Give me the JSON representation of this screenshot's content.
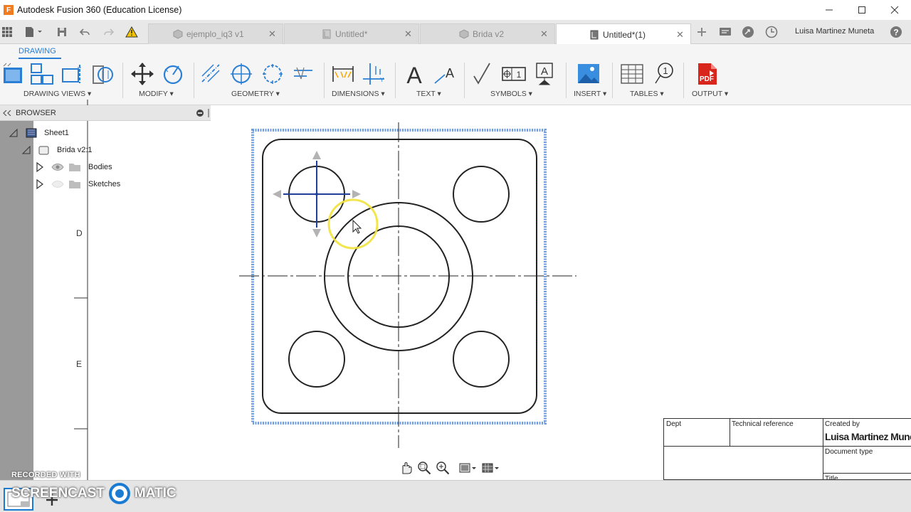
{
  "window": {
    "title": "Autodesk Fusion 360 (Education License)",
    "logo_letter": "F"
  },
  "tabs": [
    {
      "label": "ejemplo_iq3 v1",
      "icon": "part-icon",
      "active": false
    },
    {
      "label": "Untitled*",
      "icon": "drawing-icon",
      "active": false
    },
    {
      "label": "Brida v2",
      "icon": "part-icon",
      "active": false
    },
    {
      "label": "Untitled*(1)",
      "icon": "drawing-icon",
      "active": true
    }
  ],
  "user": {
    "name": "Luisa Martinez Muneta"
  },
  "ribbon": {
    "workspace": "DRAWING",
    "groups": [
      {
        "label": "DRAWING VIEWS ▾"
      },
      {
        "label": "MODIFY ▾"
      },
      {
        "label": "GEOMETRY ▾"
      },
      {
        "label": "DIMENSIONS ▾"
      },
      {
        "label": "TEXT ▾"
      },
      {
        "label": "SYMBOLS ▾"
      },
      {
        "label": "INSERT ▾"
      },
      {
        "label": "TABLES ▾"
      },
      {
        "label": "OUTPUT ▾"
      }
    ],
    "text_icon_letter": "A",
    "pdf_label": "PDF",
    "balloon_number": "1"
  },
  "browser": {
    "title": "BROWSER",
    "items": [
      {
        "label": "Sheet1"
      },
      {
        "label": "Brida v2:1"
      },
      {
        "label": "Bodies"
      },
      {
        "label": "Sketches"
      }
    ]
  },
  "sheet": {
    "zone_letters": [
      "D",
      "E"
    ]
  },
  "title_block": {
    "dept": "Dept",
    "technical_reference": "Technical reference",
    "created_by_label": "Created by",
    "created_by_value": "Luisa Martinez Muneta",
    "document_type": "Document type",
    "title_label": "Title"
  },
  "watermark": {
    "line1": "RECORDED WITH",
    "line2a": "SCREENCAST",
    "line2b": "MATIC"
  },
  "colors": {
    "accent": "#2a7fd5",
    "selection": "#6f9de0",
    "cursor_highlight": "#f2e23a"
  }
}
